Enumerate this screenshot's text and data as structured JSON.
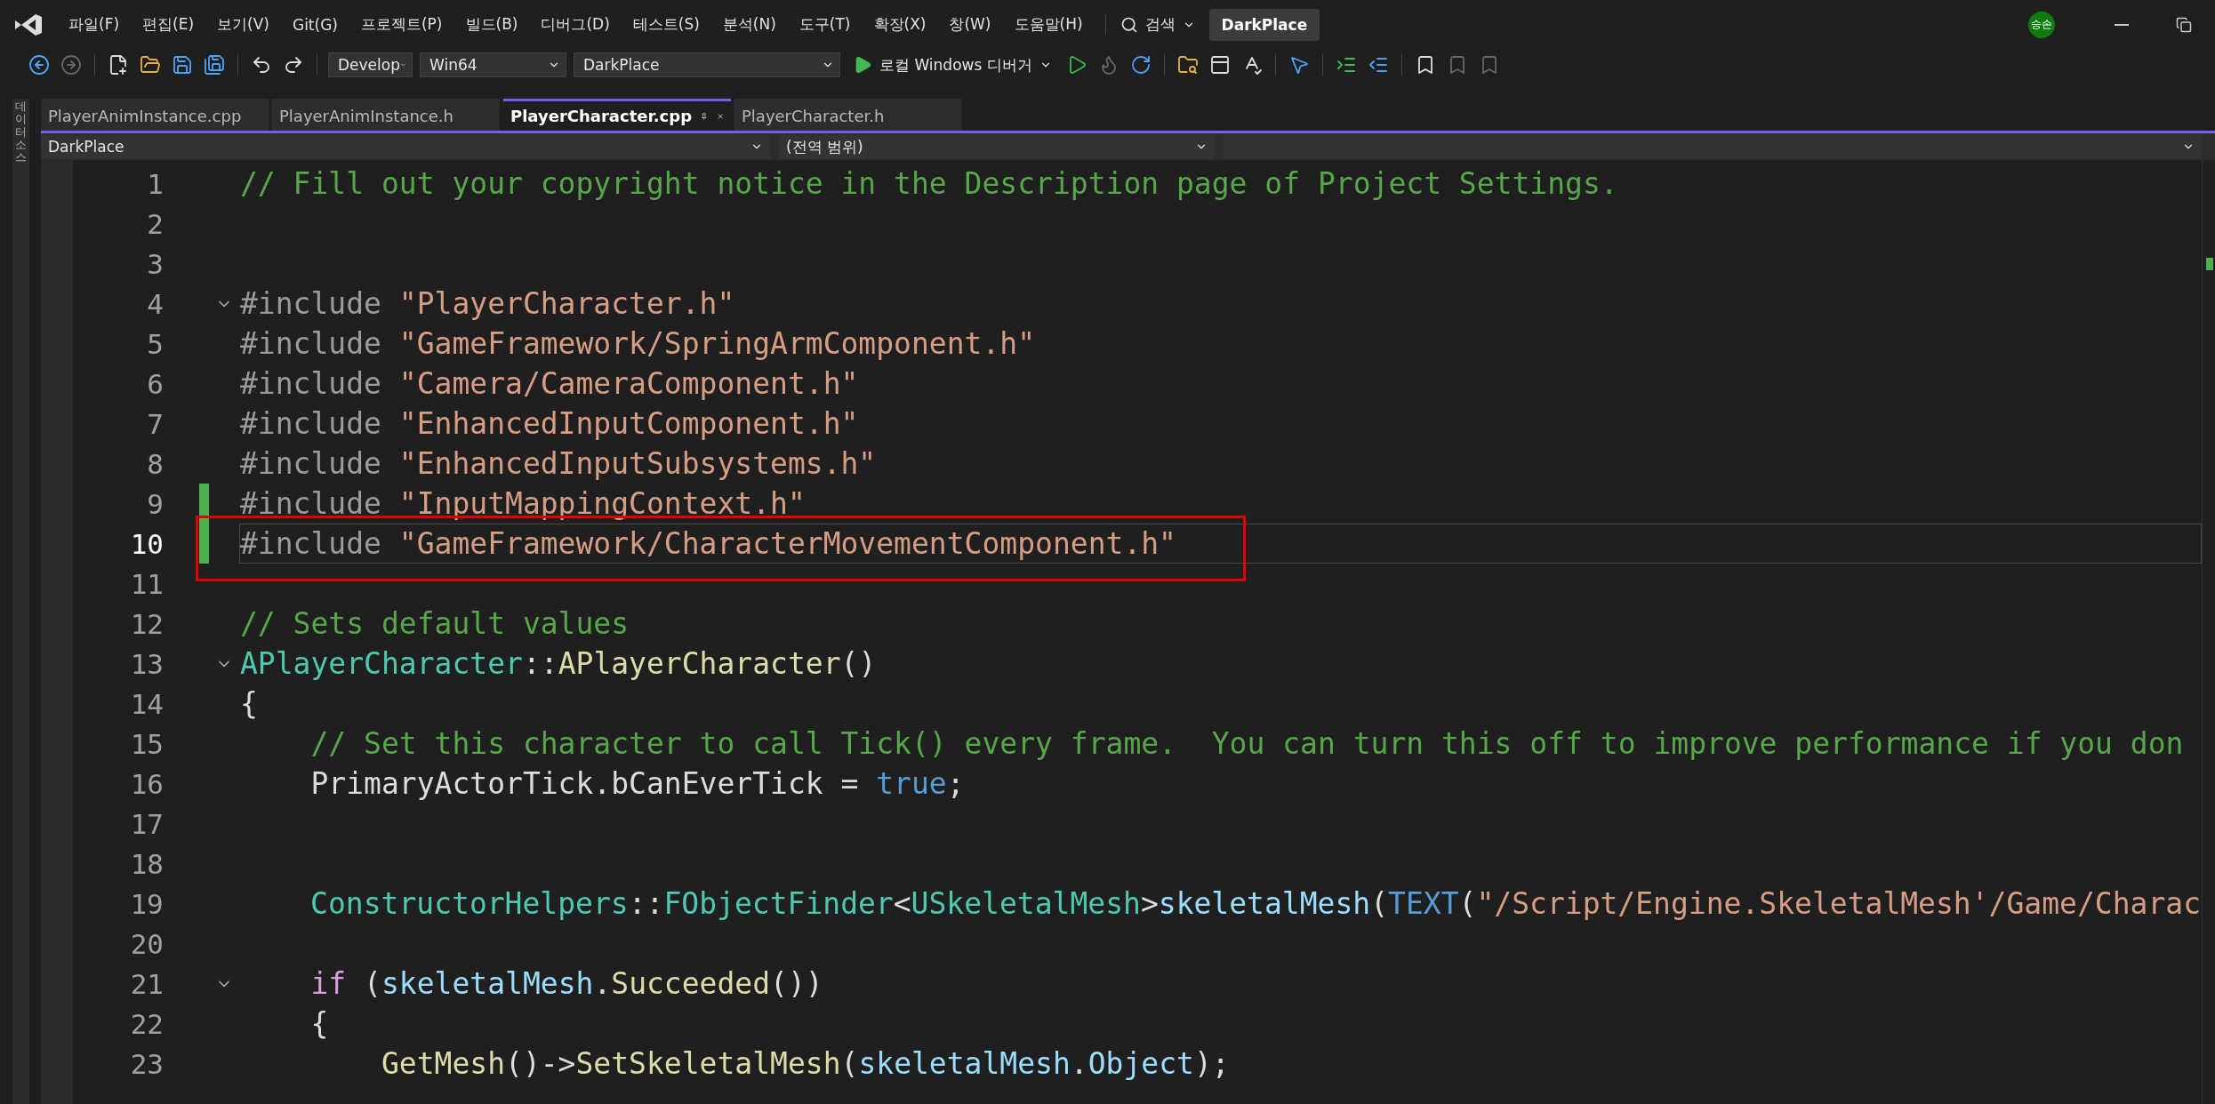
{
  "menu": [
    "파일(F)",
    "편집(E)",
    "보기(V)",
    "Git(G)",
    "프로젝트(P)",
    "빌드(B)",
    "디버그(D)",
    "테스트(S)",
    "분석(N)",
    "도구(T)",
    "확장(X)",
    "창(W)",
    "도움말(H)"
  ],
  "search": {
    "label": "검색"
  },
  "solution_title": "DarkPlace",
  "avatar": "승손",
  "toolbar": {
    "configuration": "Develop",
    "platform": "Win64",
    "startup_project": "DarkPlace",
    "run_label": "로컬 Windows 디버거"
  },
  "side_strip": "데이터 소스",
  "tabs": [
    {
      "label": "PlayerAnimInstance.cpp",
      "selected": false
    },
    {
      "label": "PlayerAnimInstance.h",
      "selected": false
    },
    {
      "label": "PlayerCharacter.cpp",
      "selected": true
    },
    {
      "label": "PlayerCharacter.h",
      "selected": false
    }
  ],
  "nav": {
    "project": "DarkPlace",
    "scope": "(전역 범위)"
  },
  "lines": [
    {
      "number": "1",
      "fold": false,
      "changed": false,
      "current": false,
      "tokens": [
        {
          "kind": "comment",
          "text": "// Fill out your copyright notice in the Description page of Project Settings."
        }
      ]
    },
    {
      "number": "2",
      "fold": false,
      "changed": false,
      "current": false
    },
    {
      "number": "3",
      "fold": false,
      "changed": false,
      "current": false
    },
    {
      "number": "4",
      "fold": true,
      "changed": false,
      "current": false,
      "tokens": [
        {
          "kind": "macro",
          "text": "#include "
        },
        {
          "kind": "string",
          "text": "\"PlayerCharacter.h\""
        }
      ]
    },
    {
      "number": "5",
      "fold": false,
      "changed": false,
      "current": false,
      "tokens": [
        {
          "kind": "macro",
          "text": "#include "
        },
        {
          "kind": "string",
          "text": "\"GameFramework/SpringArmComponent.h\""
        }
      ]
    },
    {
      "number": "6",
      "fold": false,
      "changed": false,
      "current": false,
      "tokens": [
        {
          "kind": "macro",
          "text": "#include "
        },
        {
          "kind": "string",
          "text": "\"Camera/CameraComponent.h\""
        }
      ]
    },
    {
      "number": "7",
      "fold": false,
      "changed": false,
      "current": false,
      "tokens": [
        {
          "kind": "macro",
          "text": "#include "
        },
        {
          "kind": "string",
          "text": "\"EnhancedInputComponent.h\""
        }
      ]
    },
    {
      "number": "8",
      "fold": false,
      "changed": false,
      "current": false,
      "tokens": [
        {
          "kind": "macro",
          "text": "#include "
        },
        {
          "kind": "string",
          "text": "\"EnhancedInputSubsystems.h\""
        }
      ]
    },
    {
      "number": "9",
      "fold": false,
      "changed": true,
      "current": false,
      "tokens": [
        {
          "kind": "macro",
          "text": "#include "
        },
        {
          "kind": "string",
          "text": "\"InputMappingContext.h\""
        }
      ]
    },
    {
      "number": "10",
      "fold": false,
      "changed": true,
      "current": true,
      "tokens": [
        {
          "kind": "macro",
          "text": "#include "
        },
        {
          "kind": "string",
          "text": "\"GameFramework/CharacterMovementComponent.h\""
        }
      ]
    },
    {
      "number": "11",
      "fold": false,
      "changed": false,
      "current": false
    },
    {
      "number": "12",
      "fold": false,
      "changed": false,
      "current": false,
      "tokens": [
        {
          "kind": "comment",
          "text": "// Sets default values"
        }
      ]
    },
    {
      "number": "13",
      "fold": true,
      "changed": false,
      "current": false,
      "tokens": [
        {
          "kind": "type",
          "text": "APlayerCharacter"
        },
        {
          "kind": "plain",
          "text": "::"
        },
        {
          "kind": "function",
          "text": "APlayerCharacter"
        },
        {
          "kind": "plain",
          "text": "()"
        }
      ]
    },
    {
      "number": "14",
      "fold": false,
      "changed": false,
      "current": false,
      "tokens": [
        {
          "kind": "plain",
          "text": "{"
        }
      ]
    },
    {
      "number": "15",
      "fold": false,
      "changed": false,
      "current": false,
      "tokens": [
        {
          "kind": "comment",
          "text": "    // Set this character to call Tick() every frame.  You can turn this off to improve performance if you don"
        }
      ]
    },
    {
      "number": "16",
      "fold": false,
      "changed": false,
      "current": false,
      "tokens": [
        {
          "kind": "plain",
          "text": "    PrimaryActorTick.bCanEverTick = "
        },
        {
          "kind": "keyword",
          "text": "true"
        },
        {
          "kind": "plain",
          "text": ";"
        }
      ]
    },
    {
      "number": "17",
      "fold": false,
      "changed": false,
      "current": false
    },
    {
      "number": "18",
      "fold": false,
      "changed": false,
      "current": false
    },
    {
      "number": "19",
      "fold": false,
      "changed": false,
      "current": false,
      "tokens": [
        {
          "kind": "type",
          "text": "    ConstructorHelpers"
        },
        {
          "kind": "plain",
          "text": "::"
        },
        {
          "kind": "type",
          "text": "FObjectFinder"
        },
        {
          "kind": "plain",
          "text": "<"
        },
        {
          "kind": "type",
          "text": "USkeletalMesh"
        },
        {
          "kind": "plain",
          "text": ">"
        },
        {
          "kind": "variable",
          "text": "skeletalMesh"
        },
        {
          "kind": "plain",
          "text": "("
        },
        {
          "kind": "keyword",
          "text": "TEXT"
        },
        {
          "kind": "plain",
          "text": "("
        },
        {
          "kind": "string",
          "text": "\"/Script/Engine.SkeletalMesh'/Game/Charac"
        }
      ]
    },
    {
      "number": "20",
      "fold": false,
      "changed": false,
      "current": false
    },
    {
      "number": "21",
      "fold": true,
      "changed": false,
      "current": false,
      "tokens": [
        {
          "kind": "control",
          "text": "    if"
        },
        {
          "kind": "plain",
          "text": " ("
        },
        {
          "kind": "variable",
          "text": "skeletalMesh"
        },
        {
          "kind": "plain",
          "text": "."
        },
        {
          "kind": "function",
          "text": "Succeeded"
        },
        {
          "kind": "plain",
          "text": "())"
        }
      ]
    },
    {
      "number": "22",
      "fold": false,
      "changed": false,
      "current": false,
      "tokens": [
        {
          "kind": "plain",
          "text": "    {"
        }
      ]
    },
    {
      "number": "23",
      "fold": false,
      "changed": false,
      "current": false,
      "tokens": [
        {
          "kind": "function",
          "text": "        GetMesh"
        },
        {
          "kind": "plain",
          "text": "()->"
        },
        {
          "kind": "function",
          "text": "SetSkeletalMesh"
        },
        {
          "kind": "plain",
          "text": "("
        },
        {
          "kind": "variable",
          "text": "skeletalMesh"
        },
        {
          "kind": "plain",
          "text": "."
        },
        {
          "kind": "variable",
          "text": "Object"
        },
        {
          "kind": "plain",
          "text": ");"
        }
      ]
    }
  ]
}
